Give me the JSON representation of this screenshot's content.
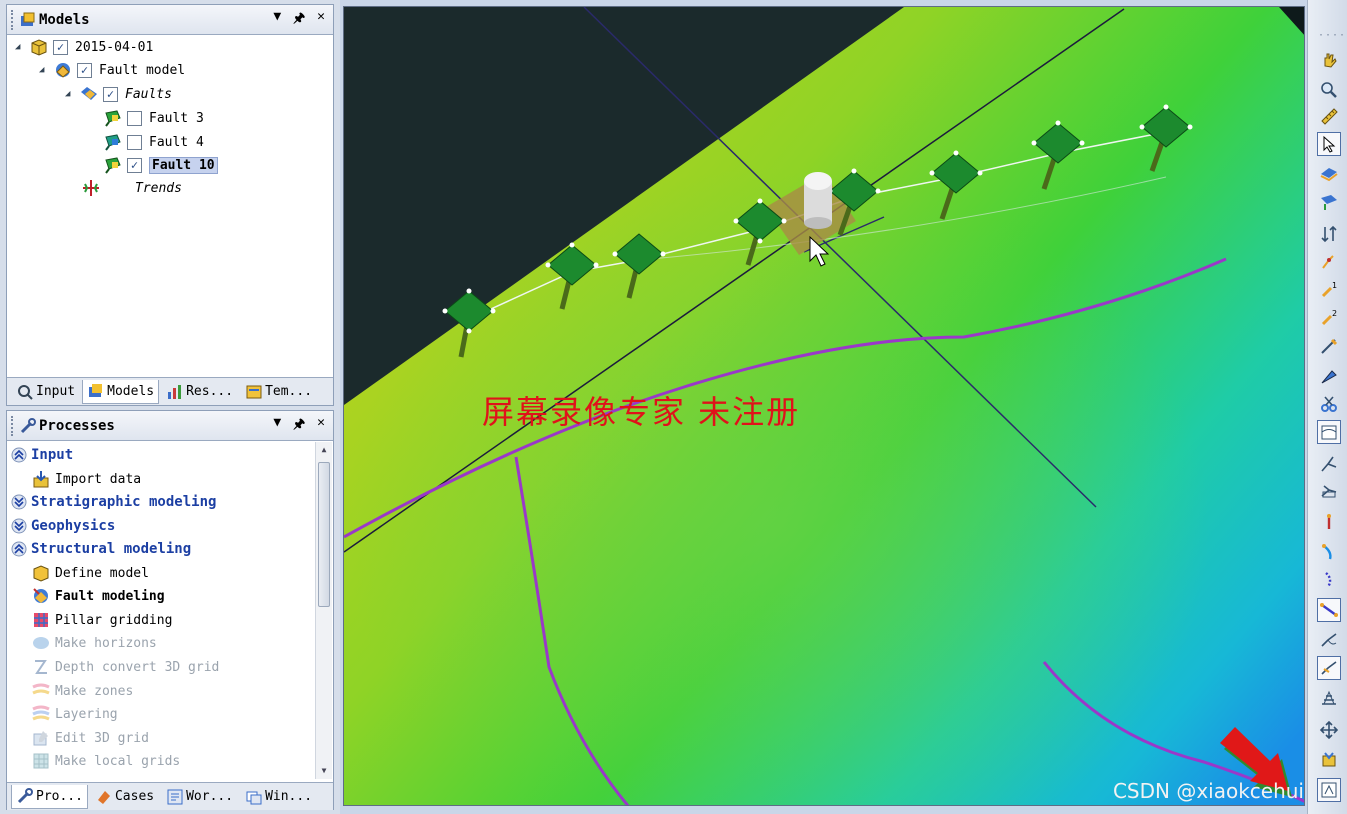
{
  "models_panel": {
    "title": "Models",
    "tree": [
      {
        "label": "2015-04-01",
        "checked": true,
        "bold": false,
        "italic": false,
        "selected": false
      },
      {
        "label": "Fault model",
        "checked": true,
        "bold": false,
        "italic": false,
        "selected": false
      },
      {
        "label": "Faults",
        "checked": true,
        "bold": false,
        "italic": true,
        "selected": false
      },
      {
        "label": "Fault 3",
        "checked": false,
        "bold": false,
        "italic": false,
        "selected": false
      },
      {
        "label": "Fault 4",
        "checked": false,
        "bold": false,
        "italic": false,
        "selected": false
      },
      {
        "label": "Fault 10",
        "checked": true,
        "bold": true,
        "italic": false,
        "selected": true
      },
      {
        "label": "Trends",
        "checked": null,
        "bold": false,
        "italic": true,
        "selected": false
      }
    ],
    "tabs": [
      "Input",
      "Models",
      "Res...",
      "Tem..."
    ]
  },
  "processes_panel": {
    "title": "Processes",
    "items": [
      {
        "type": "section",
        "label": "Input",
        "expanded": true
      },
      {
        "type": "item",
        "label": "Import data",
        "icon": "import-data-icon",
        "enabled": true,
        "bold": false
      },
      {
        "type": "section",
        "label": "Stratigraphic modeling",
        "expanded": false
      },
      {
        "type": "section",
        "label": "Geophysics",
        "expanded": false
      },
      {
        "type": "section",
        "label": "Structural modeling",
        "expanded": true
      },
      {
        "type": "item",
        "label": "Define model",
        "icon": "define-model-icon",
        "enabled": true,
        "bold": false
      },
      {
        "type": "item",
        "label": "Fault modeling",
        "icon": "fault-modeling-icon",
        "enabled": true,
        "bold": true
      },
      {
        "type": "item",
        "label": "Pillar gridding",
        "icon": "pillar-gridding-icon",
        "enabled": true,
        "bold": false
      },
      {
        "type": "item",
        "label": "Make horizons",
        "icon": "make-horizons-icon",
        "enabled": false,
        "bold": false
      },
      {
        "type": "item",
        "label": "Depth convert 3D grid",
        "icon": "depth-convert-icon",
        "enabled": false,
        "bold": false
      },
      {
        "type": "item",
        "label": "Make zones",
        "icon": "make-zones-icon",
        "enabled": false,
        "bold": false
      },
      {
        "type": "item",
        "label": "Layering",
        "icon": "layering-icon",
        "enabled": false,
        "bold": false
      },
      {
        "type": "item",
        "label": "Edit 3D grid",
        "icon": "edit-3d-grid-icon",
        "enabled": false,
        "bold": false
      },
      {
        "type": "item",
        "label": "Make local grids",
        "icon": "make-local-grids-icon",
        "enabled": false,
        "bold": false
      }
    ],
    "tabs": [
      "Pro...",
      "Cases",
      "Wor...",
      "Win..."
    ]
  },
  "viewport": {
    "watermark": "屏幕录像专家 未注册",
    "credit": "CSDN @xiaokcehui"
  },
  "colors": {
    "accent": "#1c3fa3",
    "surface_yellow": "#c4d21a",
    "surface_green": "#3fd13a",
    "surface_cyan": "#17c9c9",
    "surface_blue": "#1a8ee6",
    "fault_line": "#9a38c9",
    "pillar_green": "#1c8a2e",
    "background": "#1b2a2c"
  },
  "toolbar_icons": [
    "pan-hand-icon",
    "zoom-magnifier-icon",
    "ruler-measure-icon",
    "select-pointer-icon",
    "surface-tool-icon",
    "surface-tool-2-icon",
    "flip-arrows-icon",
    "node-1-icon",
    "node-superscript-1-icon",
    "node-superscript-2-icon",
    "pick-pen-icon",
    "edit-pen-icon",
    "scissors-icon",
    "pillar-frame-icon",
    "pillar-add-icon",
    "pillar-connect-icon",
    "single-pillar-icon",
    "pillar-bend-icon",
    "pillar-dots-icon",
    "pillar-chain-icon",
    "pillar-curve-icon",
    "pillar-curve-2-icon",
    "pillar-grid-icon",
    "move-cross-icon",
    "snap-icon",
    "frame-icon"
  ]
}
